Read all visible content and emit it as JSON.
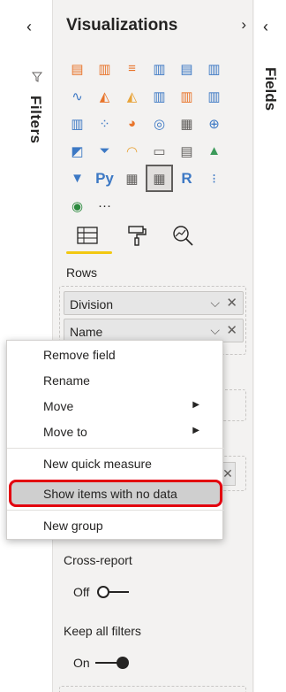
{
  "filters_pane": {
    "label": "Filters",
    "collapse_glyph": "‹"
  },
  "visualizations": {
    "title": "Visualizations",
    "expand_glyph": "›",
    "rows": [
      [
        {
          "name": "stacked-bar-chart-icon",
          "glyph": "▤",
          "color": "#e8742a"
        },
        {
          "name": "stacked-column-chart-icon",
          "glyph": "▥",
          "color": "#e8742a"
        },
        {
          "name": "clustered-bar-chart-icon",
          "glyph": "≡",
          "color": "#e8742a"
        },
        {
          "name": "clustered-column-chart-icon",
          "glyph": "▥",
          "color": "#3c78c4"
        },
        {
          "name": "100-stacked-bar-chart-icon",
          "glyph": "▤",
          "color": "#3c78c4"
        },
        {
          "name": "100-stacked-column-chart-icon",
          "glyph": "▥",
          "color": "#3c78c4"
        }
      ],
      [
        {
          "name": "line-chart-icon",
          "glyph": "∿",
          "color": "#3c78c4"
        },
        {
          "name": "area-chart-icon",
          "glyph": "◭",
          "color": "#e8742a"
        },
        {
          "name": "stacked-area-chart-icon",
          "glyph": "◭",
          "color": "#e8a43a"
        },
        {
          "name": "line-and-stacked-column-chart-icon",
          "glyph": "▥",
          "color": "#3c78c4"
        },
        {
          "name": "line-and-clustered-column-chart-icon",
          "glyph": "▥",
          "color": "#e8742a"
        },
        {
          "name": "ribbon-chart-icon",
          "glyph": "▥",
          "color": "#3c78c4"
        }
      ],
      [
        {
          "name": "waterfall-chart-icon",
          "glyph": "▥",
          "color": "#3c78c4"
        },
        {
          "name": "scatter-chart-icon",
          "glyph": "⁘",
          "color": "#3c78c4"
        },
        {
          "name": "pie-chart-icon",
          "glyph": "◕",
          "color": "#e8742a"
        },
        {
          "name": "donut-chart-icon",
          "glyph": "◎",
          "color": "#3c78c4"
        },
        {
          "name": "treemap-icon",
          "glyph": "▦",
          "color": "#605e5c"
        },
        {
          "name": "map-icon",
          "glyph": "⊕",
          "color": "#3c78c4"
        }
      ],
      [
        {
          "name": "filled-map-icon",
          "glyph": "◩",
          "color": "#3c78c4"
        },
        {
          "name": "funnel-icon",
          "glyph": "⏷",
          "color": "#3c78c4"
        },
        {
          "name": "gauge-icon",
          "glyph": "◠",
          "color": "#e8a43a"
        },
        {
          "name": "card-icon",
          "glyph": "▭",
          "color": "#605e5c"
        },
        {
          "name": "multi-row-card-icon",
          "glyph": "▤",
          "color": "#605e5c"
        },
        {
          "name": "kpi-icon",
          "glyph": "▲",
          "color": "#3c9a5a"
        }
      ],
      [
        {
          "name": "slicer-icon",
          "glyph": "▼",
          "color": "#3c78c4"
        },
        {
          "name": "python-visual-icon",
          "glyph": "Py",
          "color": "#3c78c4"
        },
        {
          "name": "table-icon",
          "glyph": "▦",
          "color": "#605e5c"
        },
        {
          "name": "matrix-icon",
          "glyph": "▦",
          "color": "#605e5c",
          "selected": true
        },
        {
          "name": "r-visual-icon",
          "glyph": "R",
          "color": "#3c78c4"
        },
        {
          "name": "key-influencers-icon",
          "glyph": "⁝",
          "color": "#3c78c4"
        }
      ],
      [
        {
          "name": "arcgis-map-icon",
          "glyph": "◉",
          "color": "#2b8a3e"
        },
        {
          "name": "more-visuals-icon",
          "glyph": "···",
          "color": "#252423"
        }
      ]
    ],
    "tabs": [
      {
        "name": "fields-tab",
        "glyph": "▦"
      },
      {
        "name": "format-tab",
        "glyph": "🖌"
      },
      {
        "name": "analytics-tab",
        "glyph": "🔍"
      }
    ],
    "rows_label": "Rows",
    "rows_fields": [
      {
        "label": "Division"
      },
      {
        "label": "Name"
      }
    ],
    "cross_report_label": "Cross-report",
    "cross_report_state": "Off",
    "keep_filters_label": "Keep all filters",
    "keep_filters_state": "On",
    "accent": "#f2c811"
  },
  "fields_pane": {
    "label": "Fields",
    "collapse_glyph": "‹"
  },
  "context_menu": {
    "items": [
      {
        "label": "Remove field"
      },
      {
        "label": "Rename"
      },
      {
        "label": "Move",
        "submenu": true
      },
      {
        "label": "Move to",
        "submenu": true
      },
      {
        "label": "New quick measure"
      },
      {
        "label": "Show items with no data",
        "highlighted": true
      },
      {
        "label": "New group"
      }
    ],
    "highlight_color": "#e3000f"
  }
}
